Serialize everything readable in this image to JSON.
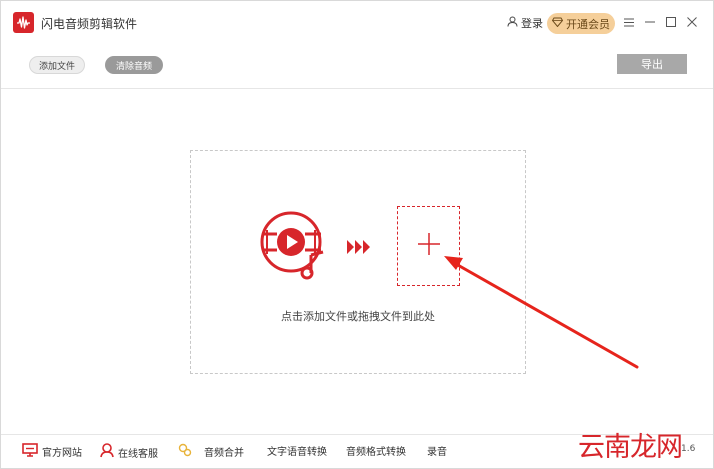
{
  "app": {
    "title": "闪电音频剪辑软件",
    "brand_color": "#d7262b"
  },
  "titlebar": {
    "login_label": "登录",
    "vip_label": "开通会员"
  },
  "toolbar": {
    "add_file_label": "添加文件",
    "clear_audio_label": "清除音频",
    "export_label": "导出"
  },
  "dropzone": {
    "hint": "点击添加文件或拖拽文件到此处"
  },
  "bottom": {
    "items": [
      {
        "label": "官方网站",
        "icon": "monitor-icon"
      },
      {
        "label": "在线客服",
        "icon": "support-icon"
      },
      {
        "label": "音频合并",
        "icon": "merge-icon"
      },
      {
        "label": "文字语音转换",
        "icon": ""
      },
      {
        "label": "音频格式转换",
        "icon": ""
      },
      {
        "label": "录音",
        "icon": ""
      }
    ],
    "watermark": "云南龙网",
    "version": "1.6"
  }
}
